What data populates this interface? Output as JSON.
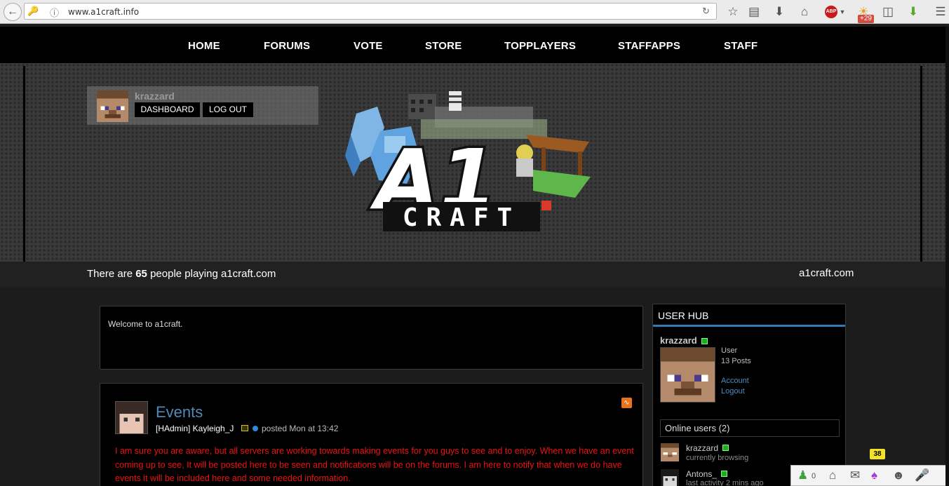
{
  "browser": {
    "url": "www.a1craft.info",
    "badge_count": "+29",
    "abp_label": "ABP"
  },
  "nav": {
    "items": [
      "HOME",
      "FORUMS",
      "VOTE",
      "STORE",
      "TOPPLAYERS",
      "STAFFAPPS",
      "STAFF"
    ]
  },
  "user_panel": {
    "username": "krazzard",
    "dashboard_label": "DASHBOARD",
    "logout_label": "LOG OUT"
  },
  "logo": {
    "main": "A1",
    "sub": "CRAFT"
  },
  "status": {
    "prefix": "There are",
    "count": "65",
    "suffix": "people playing a1craft.com",
    "site": "a1craft.com"
  },
  "welcome": {
    "text": "Welcome to a1craft."
  },
  "event_post": {
    "title": "Events",
    "author": "[HAdmin] Kayleigh_J",
    "posted": "posted Mon at 13:42",
    "body": "I am sure you are aware, but all servers are working towards making events for you guys to see and to enjoy. When we have an event coming up to see, It will be posted here to be seen and notifications will be on the forums. I am here to notify that when we do have events it will be included here and some needed information."
  },
  "hub": {
    "title": "USER HUB",
    "username": "krazzard",
    "role": "User",
    "posts": "13 Posts",
    "account_link": "Account",
    "logout_link": "Logout",
    "online_title": "Online users (2)",
    "online_users": [
      {
        "name": "krazzard",
        "status": "currently browsing"
      },
      {
        "name": "Antons_",
        "status": "last activity 2 mins ago"
      }
    ]
  },
  "bottom_bar": {
    "friends_count": "0",
    "notifications_count": "38"
  }
}
